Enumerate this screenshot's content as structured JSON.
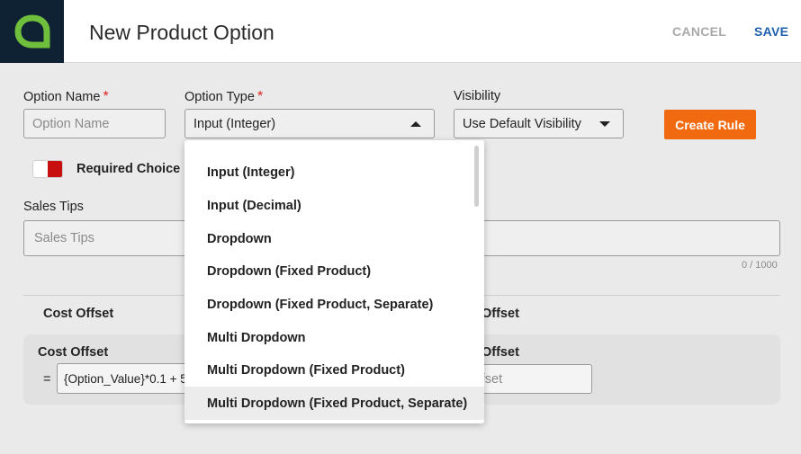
{
  "header": {
    "title": "New Product Option",
    "cancel_label": "CANCEL",
    "save_label": "SAVE"
  },
  "form": {
    "option_name": {
      "label": "Option Name",
      "required_mark": "*",
      "placeholder": "Option Name"
    },
    "option_type": {
      "label": "Option Type",
      "required_mark": "*",
      "value": "Input (Integer)"
    },
    "visibility": {
      "label": "Visibility",
      "value": "Use Default Visibility"
    },
    "create_rule_label": "Create Rule",
    "required_choice_label": "Required Choice",
    "sales_tips": {
      "label": "Sales Tips",
      "placeholder": "Sales Tips",
      "counter": "0 / 1000"
    }
  },
  "cost_section": {
    "heading_left": "Cost Offset",
    "heading_right": "Offset",
    "card_label_left": "Cost Offset",
    "card_label_right": "Offset",
    "equals": "=",
    "formula_value": "{Option_Value}*0.1 + 5",
    "offset_placeholder": "ffset"
  },
  "dropdown": {
    "options": [
      "Input (Integer)",
      "Input (Decimal)",
      "Dropdown",
      "Dropdown (Fixed Product)",
      "Dropdown (Fixed Product, Separate)",
      "Multi Dropdown",
      "Multi Dropdown (Fixed Product)",
      "Multi Dropdown (Fixed Product, Separate)"
    ],
    "hovered_index": 7
  },
  "colors": {
    "accent": "#f26a10",
    "primary": "#1f5fae",
    "logo_bg": "#0e2233",
    "logo_green": "#6fbf3d",
    "toggle_on": "#c80f0f"
  }
}
